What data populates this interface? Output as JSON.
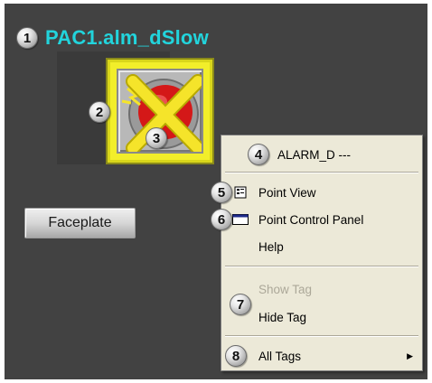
{
  "tag": {
    "title": "PAC1.alm_dSlow",
    "badge": "1"
  },
  "callouts": {
    "symbol_flash": "2",
    "symbol_alarm": "3"
  },
  "faceplate": {
    "label": "Faceplate"
  },
  "context_menu": {
    "header": {
      "badge": "4",
      "label": "ALARM_D ---"
    },
    "point_view": {
      "badge": "5",
      "label": "Point View",
      "icon": "point-view-icon"
    },
    "point_control": {
      "badge": "6",
      "label": "Point Control Panel",
      "icon": "control-panel-icon"
    },
    "help": {
      "label": "Help"
    },
    "show_tag": {
      "label": "Show Tag",
      "enabled": false
    },
    "hide_tag": {
      "badge": "7",
      "label": "Hide Tag"
    },
    "all_tags": {
      "badge": "8",
      "label": "All Tags",
      "icon": "submenu-arrow-icon"
    }
  },
  "colors": {
    "background": "#424242",
    "tag_title": "#22d4dc",
    "symbol_frame": "#f2ee2a",
    "alarm_red": "#d41818",
    "alarm_x": "#f5e42a",
    "menu_bg": "#ece9d8",
    "menu_disabled": "#aca899"
  }
}
